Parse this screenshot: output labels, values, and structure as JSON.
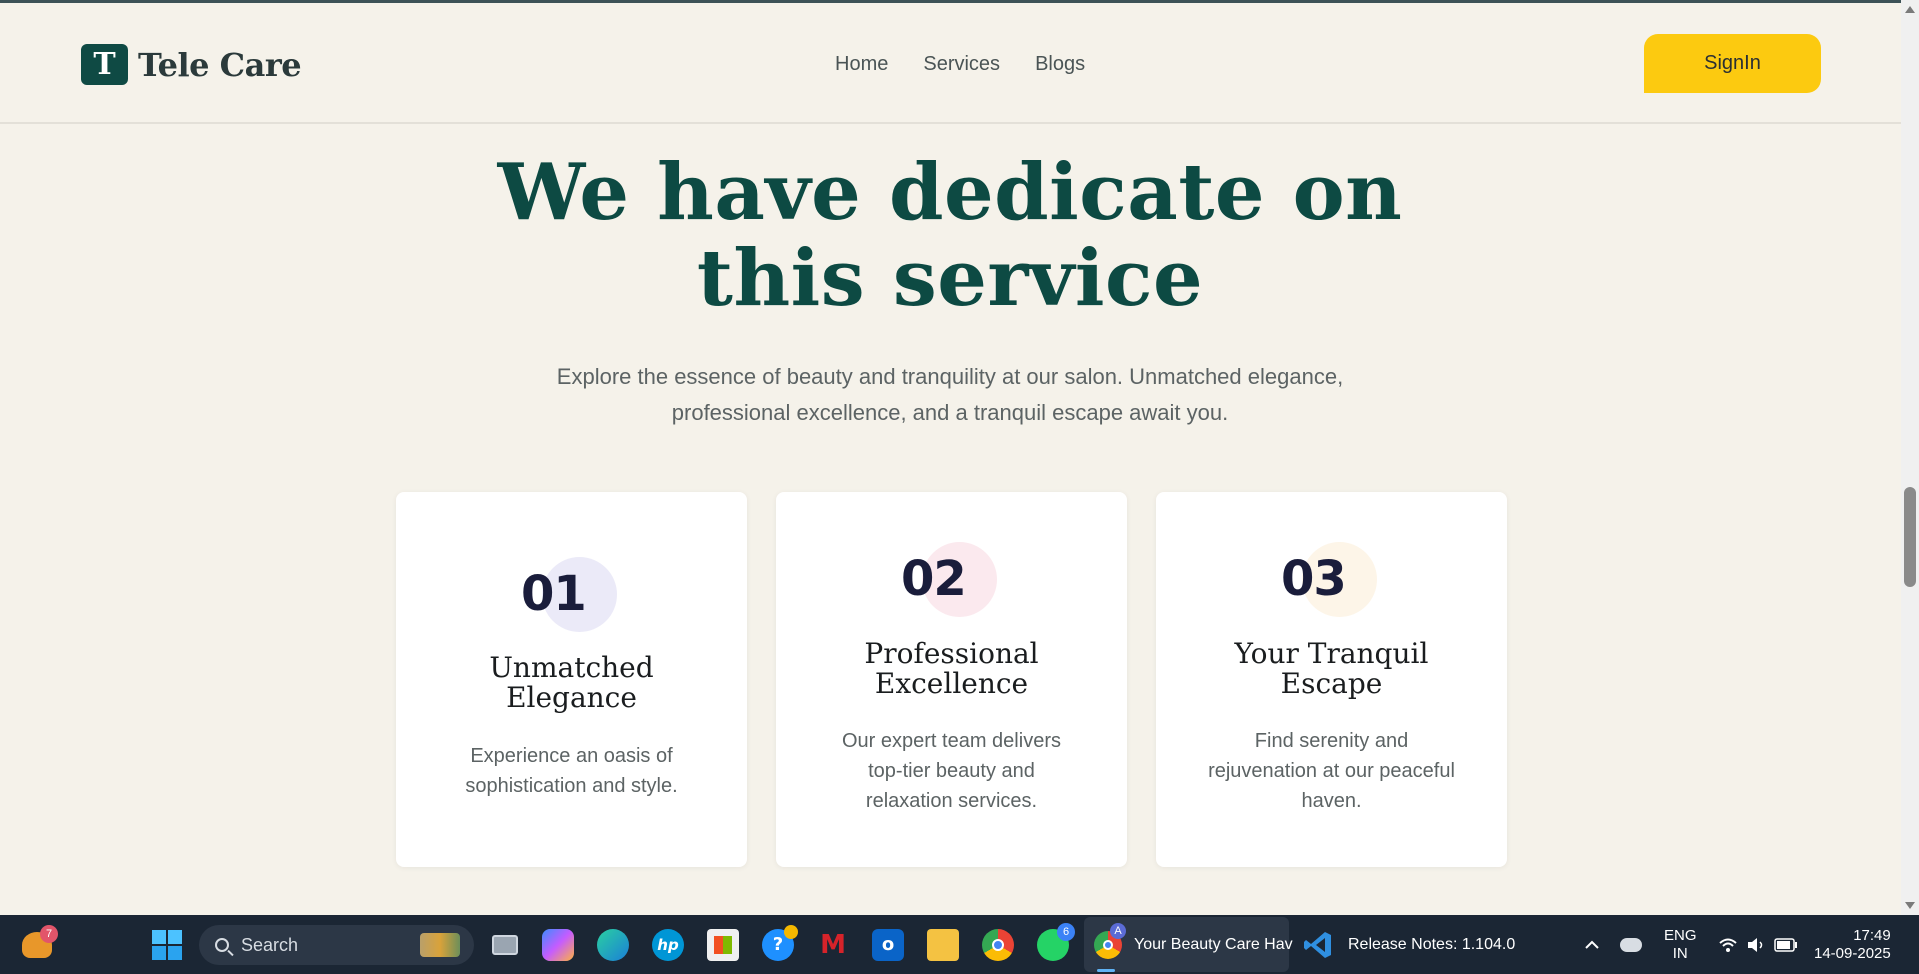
{
  "brand": {
    "logo_letter": "T",
    "name": "Tele Care"
  },
  "nav": {
    "items": [
      "Home",
      "Services",
      "Blogs"
    ],
    "signin_label": "SignIn"
  },
  "hero": {
    "heading_line1": "We have dedicate on",
    "heading_line2": "this service",
    "subtext_line1": "Explore the essence of beauty and tranquility at our salon. Unmatched elegance,",
    "subtext_line2": "professional excellence, and a tranquil escape await you."
  },
  "cards": [
    {
      "number": "01",
      "title_line1": "Unmatched",
      "title_line2": "Elegance",
      "desc_line1": "Experience an oasis of",
      "desc_line2": "sophistication and style.",
      "desc_line3": "",
      "circle_color": "#ebeaf8"
    },
    {
      "number": "02",
      "title_line1": "Professional",
      "title_line2": "Excellence",
      "desc_line1": "Our expert team delivers",
      "desc_line2": "top-tier beauty and",
      "desc_line3": "relaxation services.",
      "circle_color": "#fbe9ee"
    },
    {
      "number": "03",
      "title_line1": "Your Tranquil",
      "title_line2": "Escape",
      "desc_line1": "Find serenity and",
      "desc_line2": "rejuvenation at our peaceful",
      "desc_line3": "haven.",
      "circle_color": "#fdf5e8"
    }
  ],
  "taskbar": {
    "weather_badge": "7",
    "search_label": "Search",
    "whatsapp_badge": "6",
    "chrome_profile_badge": "A",
    "active_window_title": "Your Beauty Care Hav",
    "vscode_window_title": "Release Notes: 1.104.0",
    "lang_line1": "ENG",
    "lang_line2": "IN",
    "time": "17:49",
    "date": "14-09-2025"
  },
  "colors": {
    "page_bg": "#f5f2ea",
    "brand_green": "#0d4a43",
    "signin_yellow": "#fcca10",
    "taskbar_bg": "#1b2634"
  }
}
